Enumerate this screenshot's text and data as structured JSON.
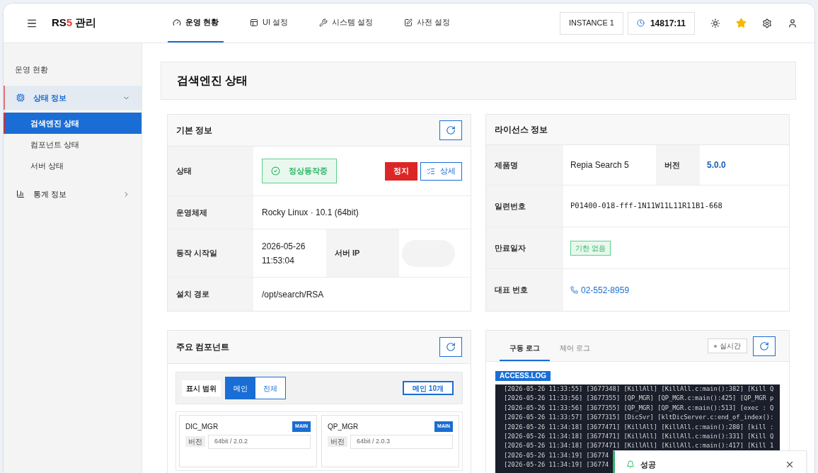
{
  "header": {
    "logo": {
      "main": "RS",
      "accent": "5",
      "suffix": "관리"
    },
    "nav": [
      {
        "label": "운영 현황",
        "selected": true
      },
      {
        "label": "UI 설정",
        "selected": false
      },
      {
        "label": "시스템 설정",
        "selected": false
      },
      {
        "label": "사전 설정",
        "selected": false
      }
    ],
    "instance": "INSTANCE 1",
    "timer": "14817:11",
    "favorite": true
  },
  "sidebar": {
    "section": "운영 현황",
    "groups": [
      {
        "label": "상태 정보",
        "expanded": true,
        "selected": true,
        "children": [
          {
            "label": "검색엔진 상태",
            "selected": true
          },
          {
            "label": "컴포넌트 상태",
            "selected": false
          },
          {
            "label": "서버 상태",
            "selected": false
          }
        ]
      },
      {
        "label": "통계 정보",
        "expanded": false,
        "selected": false
      }
    ]
  },
  "page_title": "검색엔진 상태",
  "basic_info": {
    "title": "기본 정보",
    "rows": [
      {
        "kind": "status",
        "label": "상태",
        "status": "정상동작중",
        "stop": "정지",
        "detail": "상세"
      },
      {
        "kind": "text",
        "label": "운영체제",
        "value": "Rocky Linux · 10.1 (64bit)"
      },
      {
        "kind": "split",
        "label": "동작 시작일",
        "value": "2026-05-26 11:53:04",
        "label2": "서버 IP",
        "masked": true
      },
      {
        "kind": "text",
        "label": "설치 경로",
        "value": "/opt/search/RSA"
      }
    ]
  },
  "license": {
    "title": "라이선스 정보",
    "rows": [
      {
        "kind": "split",
        "label": "제품명",
        "value": "Repia Search 5",
        "label2": "버전",
        "value2": "5.0.0"
      },
      {
        "kind": "mono",
        "label": "일련번호",
        "value": "P01400-018-fff-1N11W11L11R11B1-668"
      },
      {
        "kind": "tag",
        "label": "만료일자",
        "value": "기한 없음"
      },
      {
        "kind": "phone",
        "label": "대표 번호",
        "value": "02-552-8959"
      }
    ]
  },
  "components": {
    "title": "주요 컴포넌트",
    "scope_label": "표시 범위",
    "scopes": [
      {
        "label": "메인",
        "selected": true
      },
      {
        "label": "전체",
        "selected": false
      }
    ],
    "count": "메인 10개",
    "items": [
      {
        "name": "DIC_MGR",
        "badge": "MAIN",
        "version_label": "버전",
        "version": "64bit / 2.0.2"
      },
      {
        "name": "QP_MGR",
        "badge": "MAIN",
        "version_label": "버전",
        "version": "64bit / 2.0.3"
      }
    ]
  },
  "logs": {
    "tabs": [
      {
        "label": "구동 로그",
        "selected": true
      },
      {
        "label": "제어 로그",
        "selected": false
      }
    ],
    "live": {
      "label": "실시간",
      "on": false
    },
    "file": "ACCESS.LOG",
    "lines": [
      "[2026-05-26 11:33:55] [3677348] [KillAll] [KillAll.c:main():382] [Kill Q",
      "[2026-05-26 11:33:56] [3677355] [QP_MGR] [QP_MGR.c:main():425] [QP_MGR p",
      "[2026-05-26 11:33:56] [3677355] [QP_MGR] [QP_MGR.c:main():513] [exec : Q",
      "[2026-05-26 11:33:57] [3677315] [DicSvr] [kltDicServer.c:end_of_index():",
      "[2026-05-26 11:34:18] [3677471] [KillAll] [KillAll.c:main():280] [kill :",
      "[2026-05-26 11:34:18] [3677471] [KillAll] [KillAll.c:main():331] [Kill Q",
      "[2026-05-26 11:34:18] [3677471] [KillAll] [KillAll.c:main():417] [Kill 1",
      "[2026-05-26 11:34:19] [36774",
      "[2026-05-26 11:34:19] [36774"
    ]
  },
  "toast": {
    "message": "성공"
  }
}
